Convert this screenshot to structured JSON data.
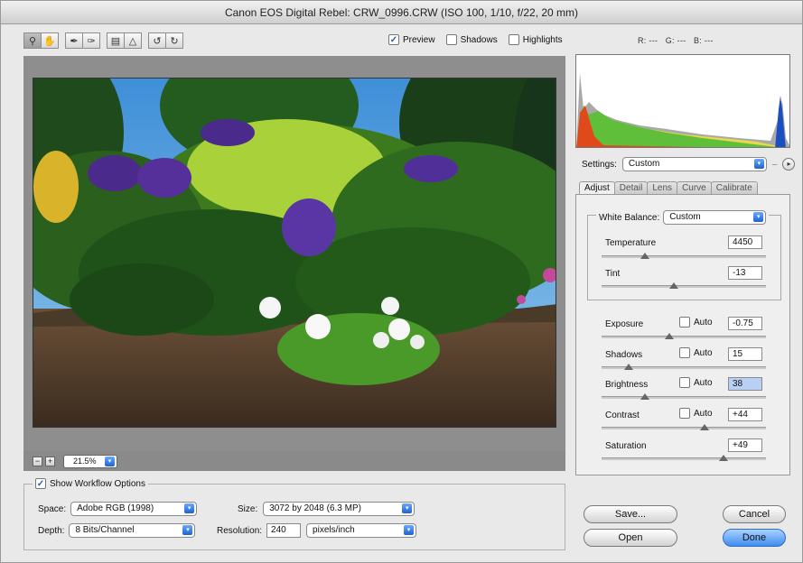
{
  "window": {
    "title": "Canon EOS Digital Rebel:  CRW_0996.CRW  (ISO 100, 1/10, f/22, 20 mm)"
  },
  "toolbar": {
    "tools": [
      {
        "name": "zoom-icon",
        "glyph": "🔍"
      },
      {
        "name": "hand-icon",
        "glyph": "✋"
      },
      {
        "name": "eyedropper-icon",
        "glyph": "✒"
      },
      {
        "name": "color-sampler-icon",
        "glyph": "✑"
      },
      {
        "name": "crop-icon",
        "glyph": "⌗"
      },
      {
        "name": "straighten-icon",
        "glyph": "◬"
      },
      {
        "name": "rotate-left-icon",
        "glyph": "↺"
      },
      {
        "name": "rotate-right-icon",
        "glyph": "↻"
      }
    ]
  },
  "preview_options": {
    "preview": {
      "label": "Preview",
      "checked": true
    },
    "shadows": {
      "label": "Shadows",
      "checked": false
    },
    "highlights": {
      "label": "Highlights",
      "checked": false
    }
  },
  "readout": {
    "r_label": "R:",
    "r_val": "---",
    "g_label": "G:",
    "g_val": "---",
    "b_label": "B:",
    "b_val": "---"
  },
  "zoom": {
    "minus": "−",
    "plus": "+",
    "value": "21.5%"
  },
  "workflow": {
    "title": "Show Workflow Options",
    "checked": true,
    "space_label": "Space:",
    "space_value": "Adobe RGB (1998)",
    "size_label": "Size:",
    "size_value": "3072 by 2048  (6.3 MP)",
    "depth_label": "Depth:",
    "depth_value": "8 Bits/Channel",
    "resolution_label": "Resolution:",
    "resolution_value": "240",
    "resolution_unit": "pixels/inch"
  },
  "settings": {
    "label": "Settings:",
    "value": "Custom"
  },
  "tabs": [
    "Adjust",
    "Detail",
    "Lens",
    "Curve",
    "Calibrate"
  ],
  "white_balance": {
    "label": "White Balance:",
    "value": "Custom"
  },
  "sliders": {
    "temperature": {
      "label": "Temperature",
      "value": "4450",
      "level": 0.33
    },
    "tint": {
      "label": "Tint",
      "value": "-13",
      "level": 0.46
    },
    "exposure": {
      "label": "Exposure",
      "value": "-0.75",
      "level": 0.41,
      "auto": "Auto"
    },
    "shadows": {
      "label": "Shadows",
      "value": "15",
      "level": 0.16,
      "auto": "Auto"
    },
    "brightness": {
      "label": "Brightness",
      "value": "38",
      "level": 0.26,
      "auto": "Auto"
    },
    "contrast": {
      "label": "Contrast",
      "value": "+44",
      "level": 0.62,
      "auto": "Auto"
    },
    "saturation": {
      "label": "Saturation",
      "value": "+49",
      "level": 0.74
    }
  },
  "buttons": {
    "save": "Save...",
    "open": "Open",
    "cancel": "Cancel",
    "done": "Done"
  },
  "colors": {
    "accent": "#3f8cf0",
    "histogram_red": "#e04a1a",
    "histogram_green": "#5fbf3a",
    "histogram_yellow": "#e7d94a",
    "histogram_blue": "#1b4fbf"
  }
}
